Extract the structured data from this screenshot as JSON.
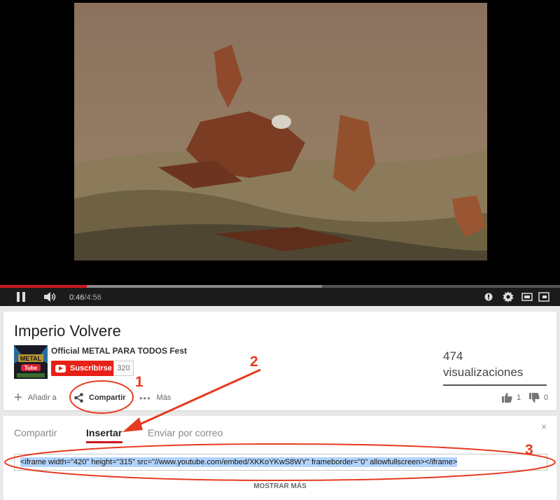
{
  "player": {
    "current_time": "0:46",
    "separator": " / ",
    "duration": "4:56",
    "progress_played": 0.155,
    "progress_buffered": 0.575,
    "icons": [
      "pause-icon",
      "volume-icon",
      "annotations-icon",
      "gear-icon",
      "theater-size-icon",
      "fullscreen-icon"
    ]
  },
  "video": {
    "title": "Imperio Volvere",
    "channel": "Official METAL PARA TODOS Fest",
    "avatar_text_top": "METAL",
    "avatar_text_bottom": "Tube",
    "subscribe_label": "Suscribirse",
    "subscriber_count": "320",
    "views_number": "474",
    "views_label": "visualizaciones",
    "like_ratio": 1.0
  },
  "actions": {
    "add_to": "Añadir a",
    "share": "Compartir",
    "more": "Más",
    "likes": "1",
    "dislikes": "0"
  },
  "share_panel": {
    "tabs": [
      "Compartir",
      "Insertar",
      "Enviar por correo"
    ],
    "active_tab": "Insertar",
    "close": "×",
    "embed_code": "<iframe width=\"420\" height=\"315\" src=\"//www.youtube.com/embed/XKKoYKwS8WY\" frameborder=\"0\" allowfullscreen></iframe>",
    "show_more": "MOSTRAR MÁS"
  },
  "annotations": {
    "numbers": [
      "1",
      "2",
      "3"
    ],
    "color": "#e63b1f"
  },
  "colors": {
    "brand_red": "#e62117",
    "progress_red": "#cc181e",
    "selection_blue": "#b3d4fc"
  }
}
